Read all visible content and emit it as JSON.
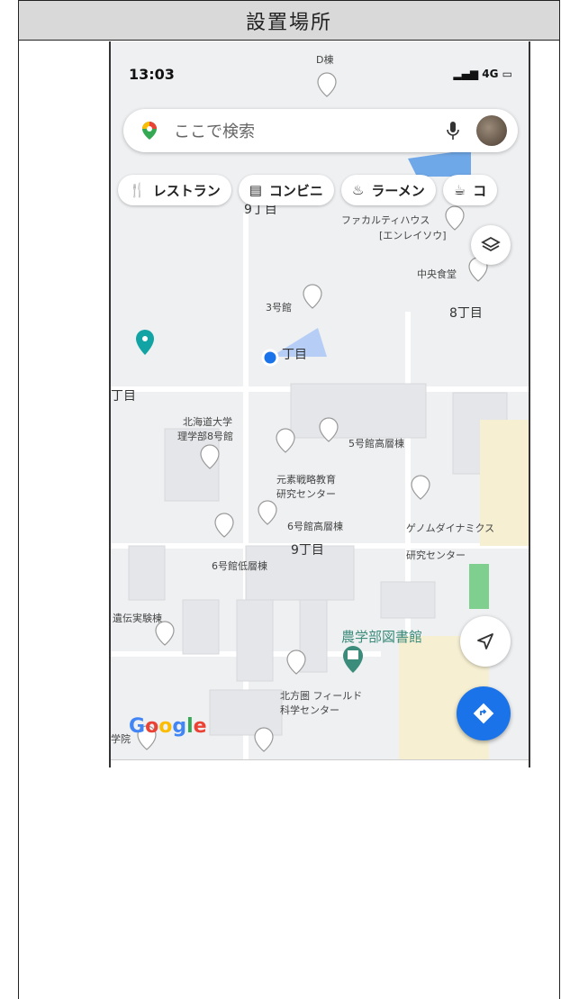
{
  "header": {
    "title": "設置場所"
  },
  "status_bar": {
    "time": "13:03",
    "network": "4G"
  },
  "search": {
    "placeholder": "ここで検索"
  },
  "chips": [
    {
      "label": "レストラン",
      "icon": "restaurant-icon"
    },
    {
      "label": "コンビニ",
      "icon": "store-icon"
    },
    {
      "label": "ラーメン",
      "icon": "ramen-icon"
    },
    {
      "label": "コ",
      "icon": "cafe-icon"
    }
  ],
  "map_labels": {
    "d_building": "D棟",
    "ninechome_top": "9丁目",
    "faculty_house": "ファカルティハウス",
    "faculty_house_sub": "[エンレイソウ]",
    "central_cafeteria": "中央食堂",
    "no3": "3号館",
    "eightchome": "8丁目",
    "chome_mid": "丁目",
    "chome_left": "丁目",
    "hokudai_sci": "北海道大学",
    "hokudai_sci2": "理学部8号館",
    "no5_high": "5号館高層棟",
    "element_strategy": "元素戦略教育",
    "element_strategy2": "研究センター",
    "no6_high": "6号館高層棟",
    "genome": "ゲノムダイナミクス",
    "genome2": "研究センター",
    "ninechome_mid": "9丁目",
    "no6_low": "6号館低層棟",
    "experiment": "遺伝実験棟",
    "agri_library": "農学部図書館",
    "north_field": "北方圏 フィールド",
    "north_field2": "科学センター",
    "gakuin": "学院"
  },
  "brand": {
    "google": "Google"
  },
  "colors": {
    "accent": "#1a73e8",
    "teal": "#12a4a4"
  }
}
